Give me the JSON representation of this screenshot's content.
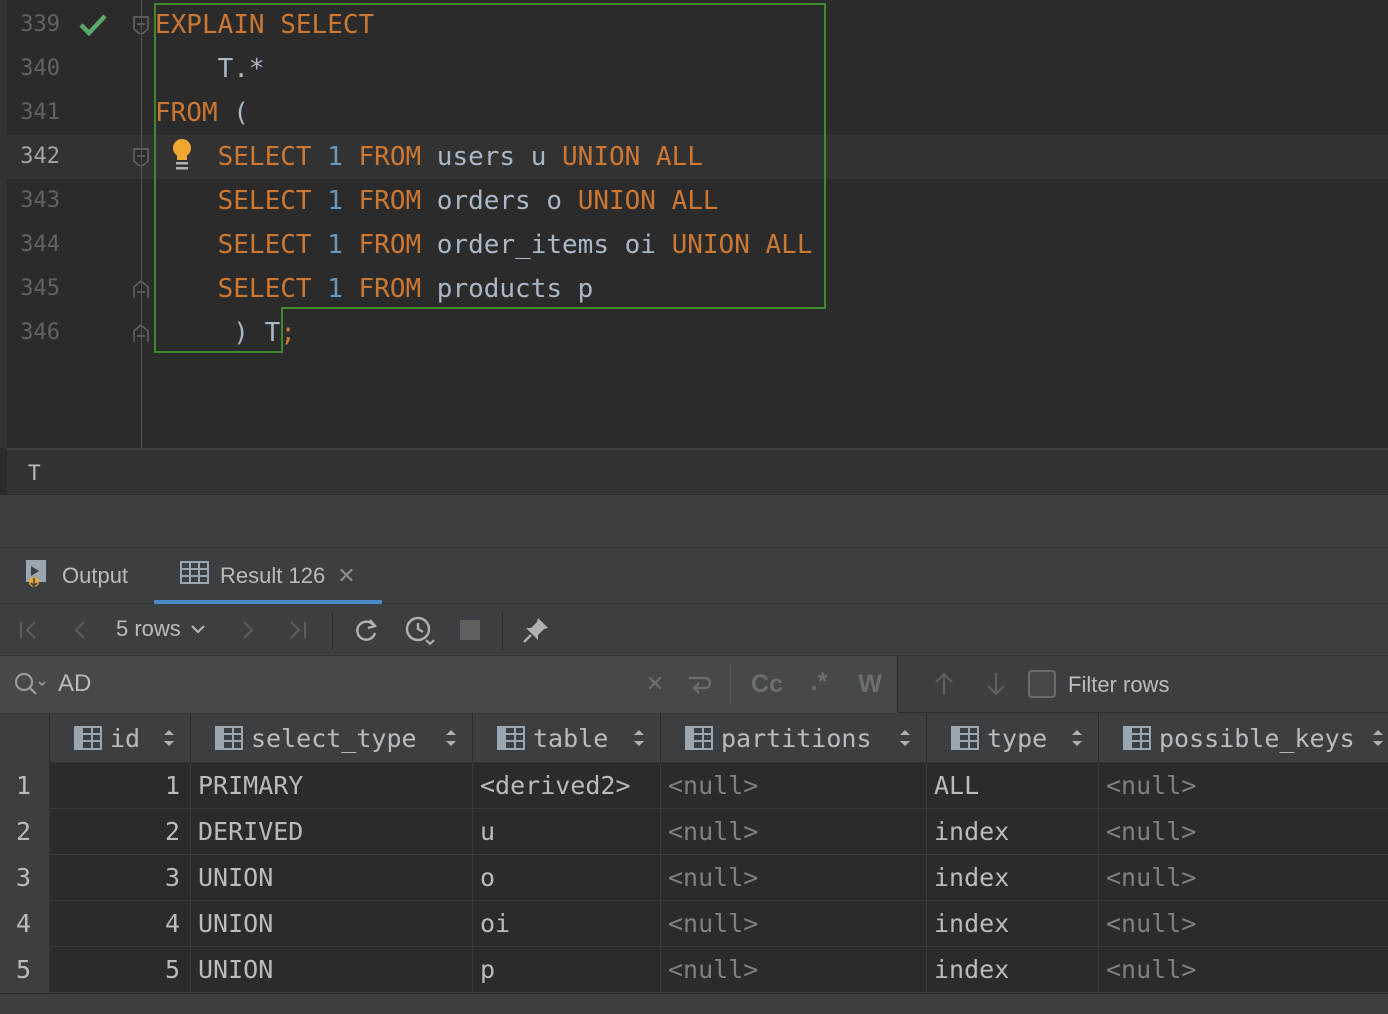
{
  "editor": {
    "lines": [
      {
        "number": "339",
        "tokens": [
          {
            "t": "EXPLAIN",
            "k": "kw"
          },
          {
            "t": " "
          },
          {
            "t": "SELECT",
            "k": "kw"
          }
        ]
      },
      {
        "number": "340",
        "tokens": [
          {
            "t": "    T.*"
          }
        ]
      },
      {
        "number": "341",
        "tokens": [
          {
            "t": "FROM",
            "k": "kw"
          },
          {
            "t": " ("
          }
        ]
      },
      {
        "number": "342",
        "tokens": [
          {
            "t": "    "
          },
          {
            "t": "SELECT",
            "k": "kw"
          },
          {
            "t": " "
          },
          {
            "t": "1",
            "k": "num"
          },
          {
            "t": " "
          },
          {
            "t": "FROM",
            "k": "kw"
          },
          {
            "t": " users u "
          },
          {
            "t": "UNION ALL",
            "k": "kw"
          }
        ]
      },
      {
        "number": "343",
        "tokens": [
          {
            "t": "    "
          },
          {
            "t": "SELECT",
            "k": "kw"
          },
          {
            "t": " "
          },
          {
            "t": "1",
            "k": "num"
          },
          {
            "t": " "
          },
          {
            "t": "FROM",
            "k": "kw"
          },
          {
            "t": " orders o "
          },
          {
            "t": "UNION ALL",
            "k": "kw"
          }
        ]
      },
      {
        "number": "344",
        "tokens": [
          {
            "t": "    "
          },
          {
            "t": "SELECT",
            "k": "kw"
          },
          {
            "t": " "
          },
          {
            "t": "1",
            "k": "num"
          },
          {
            "t": " "
          },
          {
            "t": "FROM",
            "k": "kw"
          },
          {
            "t": " order_items oi "
          },
          {
            "t": "UNION ALL",
            "k": "kw"
          }
        ]
      },
      {
        "number": "345",
        "tokens": [
          {
            "t": "    "
          },
          {
            "t": "SELECT",
            "k": "kw"
          },
          {
            "t": " "
          },
          {
            "t": "1",
            "k": "num"
          },
          {
            "t": " "
          },
          {
            "t": "FROM",
            "k": "kw"
          },
          {
            "t": " products p"
          }
        ]
      },
      {
        "number": "346",
        "tokens": [
          {
            "t": "     ) T"
          },
          {
            "t": ";",
            "k": "kw"
          }
        ]
      }
    ],
    "current_line": "342",
    "breadcrumb": "T"
  },
  "tabs": {
    "output_label": "Output",
    "result_label": "Result 126"
  },
  "toolbar": {
    "rows_label": "5 rows"
  },
  "filter": {
    "search_value": "AD",
    "filter_rows_label": "Filter rows",
    "match_case_label": "Cc",
    "regex_label": ".*",
    "words_label": "W"
  },
  "grid": {
    "columns": [
      "id",
      "select_type",
      "table",
      "partitions",
      "type",
      "possible_keys"
    ],
    "rows": [
      {
        "num": "1",
        "id": "1",
        "select_type": "PRIMARY",
        "table": "<derived2>",
        "partitions": "<null>",
        "type": "ALL",
        "possible_keys": "<null>"
      },
      {
        "num": "2",
        "id": "2",
        "select_type": "DERIVED",
        "table": "u",
        "partitions": "<null>",
        "type": "index",
        "possible_keys": "<null>"
      },
      {
        "num": "3",
        "id": "3",
        "select_type": "UNION",
        "table": "o",
        "partitions": "<null>",
        "type": "index",
        "possible_keys": "<null>"
      },
      {
        "num": "4",
        "id": "4",
        "select_type": "UNION",
        "table": "oi",
        "partitions": "<null>",
        "type": "index",
        "possible_keys": "<null>"
      },
      {
        "num": "5",
        "id": "5",
        "select_type": "UNION",
        "table": "p",
        "partitions": "<null>",
        "type": "index",
        "possible_keys": "<null>"
      }
    ]
  },
  "colors": {
    "keyword": "#cc7832",
    "number": "#6897bb",
    "identifier": "#a9b7c6",
    "outline": "#3f8a2e",
    "check": "#59a869",
    "bulb": "#f0a732",
    "null_text": "#808080",
    "tab_accent": "#4a88c7"
  }
}
